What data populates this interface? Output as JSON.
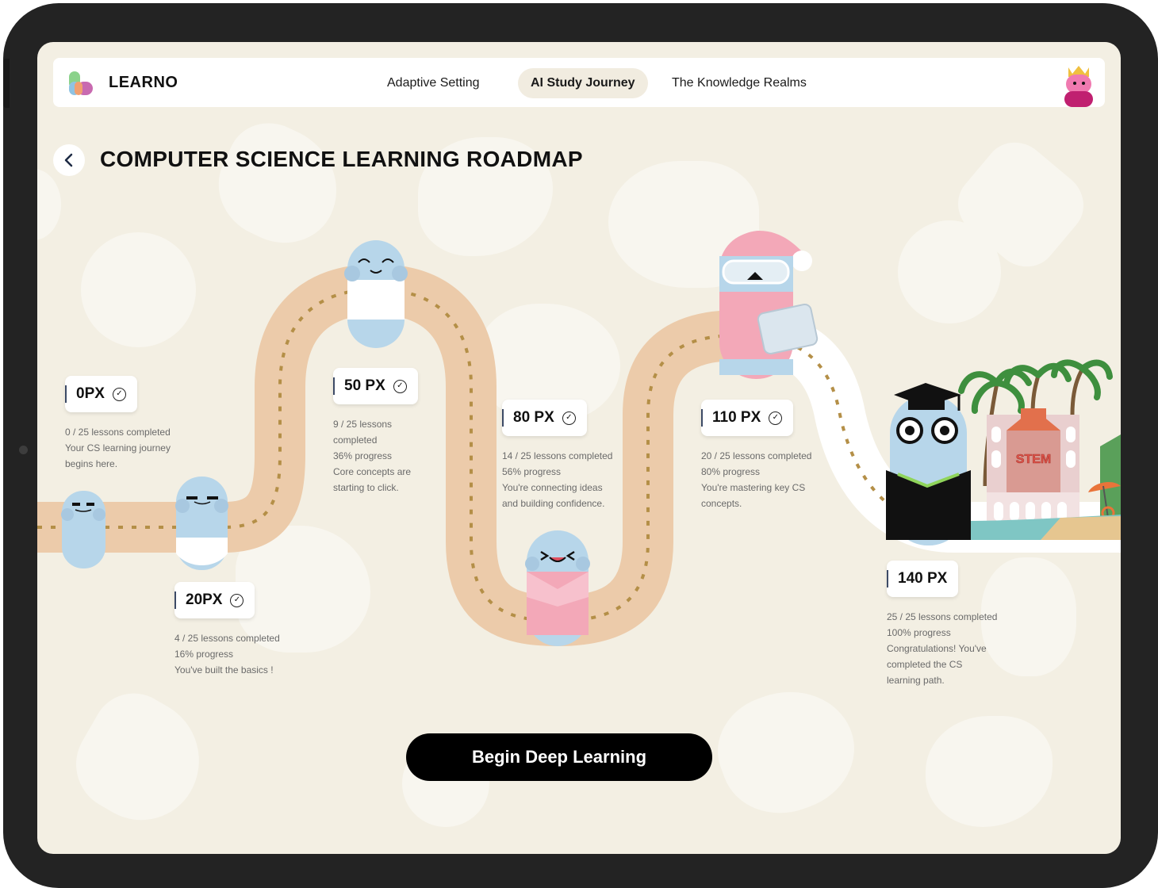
{
  "app": {
    "brand": "LEARNO"
  },
  "nav": {
    "tabs": [
      {
        "label": "Adaptive Setting",
        "active": false
      },
      {
        "label": "AI Study Journey",
        "active": true
      },
      {
        "label": "The Knowledge Realms",
        "active": false
      }
    ]
  },
  "page": {
    "title": "COMPUTER SCIENCE LEARNING ROADMAP"
  },
  "stages": [
    {
      "label": "0PX",
      "lines": [
        "0 / 25 lessons completed",
        "Your CS learning journey",
        "begins here."
      ]
    },
    {
      "label": "20PX",
      "lines": [
        "4 / 25 lessons completed",
        "16% progress",
        "You've built the basics !"
      ]
    },
    {
      "label": "50 PX",
      "lines": [
        "9 / 25 lessons",
        "completed",
        "36% progress",
        "Core concepts are",
        "starting to click."
      ]
    },
    {
      "label": "80 PX",
      "lines": [
        "14 / 25 lessons completed",
        "56% progress",
        "You're connecting ideas",
        "and building confidence."
      ]
    },
    {
      "label": "110 PX",
      "lines": [
        "20 / 25 lessons completed",
        "80% progress",
        "You're mastering key CS",
        "concepts."
      ]
    },
    {
      "label": "140 PX",
      "lines": [
        "25 / 25 lessons completed",
        "100% progress",
        "Congratulations! You've",
        "completed the CS",
        "learning path."
      ]
    }
  ],
  "scenery": {
    "building_sign": "STEM"
  },
  "cta": {
    "label": "Begin Deep Learning"
  },
  "colors": {
    "road": "#eccbaa",
    "road_done": "#ffffff",
    "road_dash": "#b48f47",
    "character_blue": "#b7d6ea",
    "character_pink": "#f3a8b8",
    "background": "#f3efe3"
  }
}
